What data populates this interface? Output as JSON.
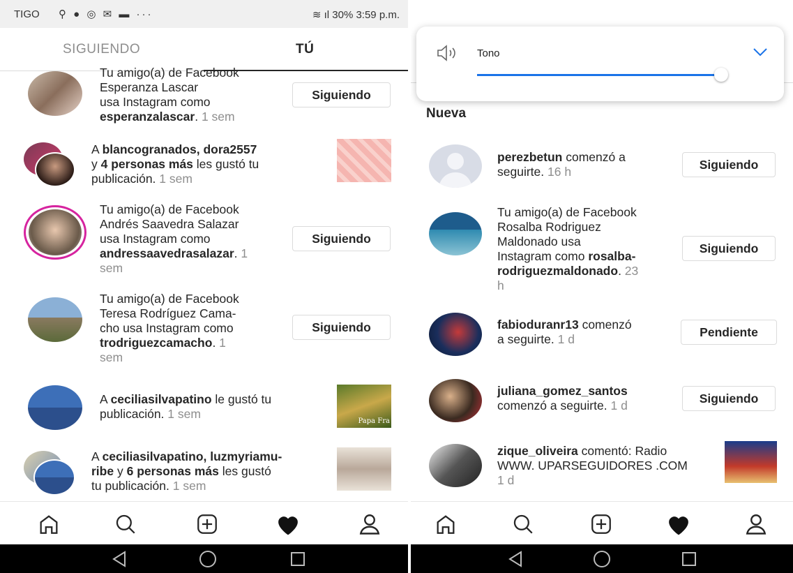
{
  "left": {
    "status": {
      "carrier": "TIGO",
      "icons": "⚲ ● ◎ ✉ ▬ ···",
      "right": "30%  3:59 p.m."
    },
    "tabs": {
      "following": "SIGUIENDO",
      "you": "TÚ"
    },
    "items": [
      {
        "line1": "Tu amigo(a) de Facebook",
        "line2": "Esperanza Lascar",
        "line3": "usa Instagram como",
        "user": "esperanzalascar",
        "time": "1 sem",
        "button": "Siguiendo"
      },
      {
        "pre": "A ",
        "users": "blancogranados, dora2557",
        "line2pre": "y ",
        "count": "4 personas más",
        "line2post": " les gustó tu",
        "line3": "publicación.",
        "time": "1 sem"
      },
      {
        "line1": "Tu amigo(a) de Facebook",
        "line2": "Andrés Saavedra Salazar",
        "line3": "usa Instagram como",
        "user": "andressaavedrasalazar",
        "time1": "1",
        "time2": "sem",
        "button": "Siguiendo"
      },
      {
        "line1": "Tu amigo(a) de Facebook",
        "line2": "Teresa Rodríguez Cama-",
        "line3": "cho usa Instagram como",
        "user": "trodriguezcamacho",
        "time1": "1",
        "time2": "sem",
        "button": "Siguiendo"
      },
      {
        "pre": "A ",
        "user": "ceciliasilvapatino",
        "post": " le gustó tu",
        "line2": "publicación.",
        "time": "1 sem",
        "thumb_caption": "Papa Fra"
      },
      {
        "pre": "A ",
        "users": "ceciliasilvapatino, luzmyriamu-",
        "line2a": "ribe",
        "line2b": " y ",
        "count": "6 personas más",
        "line2c": " les gustó",
        "line3": "tu publicación.",
        "time": "1 sem"
      }
    ]
  },
  "right": {
    "volume": {
      "label": "Tono",
      "level": 0.97
    },
    "section": "Nueva",
    "items": [
      {
        "user": "perezbetun",
        "text": " comenzó a",
        "line2": "seguirte.",
        "time": "16 h",
        "button": "Siguiendo"
      },
      {
        "line1": "Tu amigo(a) de Facebook",
        "line2": "Rosalba Rodriguez",
        "line3": "Maldonado usa",
        "line4": "Instagram como ",
        "user1": "rosalba-",
        "user2": "rodriguezmaldonado",
        "time1": "23",
        "time2": "h",
        "button": "Siguiendo"
      },
      {
        "user": "fabioduranr13",
        "text": " comenzó",
        "line2": "a seguirte.",
        "time": "1 d",
        "button": "Pendiente"
      },
      {
        "user": "juliana_gomez_santos",
        "line2": "comenzó a seguirte.",
        "time": "1 d",
        "button": "Siguiendo"
      },
      {
        "user": "zique_oliveira",
        "text": " comentó: Radio",
        "line2": "WWW. UPARSEGUIDORES .COM",
        "time": "1 d"
      }
    ]
  },
  "nav": [
    "home-icon",
    "search-icon",
    "new-post-icon",
    "activity-heart-icon",
    "profile-icon"
  ],
  "system": [
    "back-icon",
    "home-circle-icon",
    "recents-icon"
  ],
  "colors": {
    "accent": "#1a73e8",
    "story_ring": "#d6249f",
    "muted": "#8e8e8e"
  }
}
